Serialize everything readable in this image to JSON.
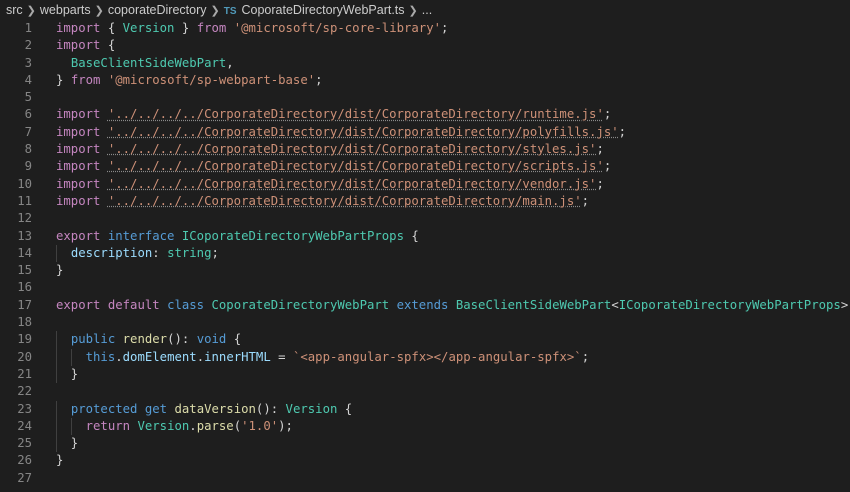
{
  "breadcrumb": {
    "items": [
      "src",
      "webparts",
      "coporateDirectory"
    ],
    "file_icon": "TS",
    "file_name": "CoporateDirectoryWebPart.ts",
    "trailing": "..."
  },
  "editor": {
    "language": "typescript",
    "theme": "dark",
    "lines": [
      {
        "num": "1",
        "tokens": [
          {
            "c": "k",
            "t": "import"
          },
          {
            "c": "p",
            "t": " { "
          },
          {
            "c": "t",
            "t": "Version"
          },
          {
            "c": "p",
            "t": " } "
          },
          {
            "c": "k",
            "t": "from"
          },
          {
            "c": "p",
            "t": " "
          },
          {
            "c": "s",
            "t": "'@microsoft/sp-core-library'"
          },
          {
            "c": "p",
            "t": ";"
          }
        ]
      },
      {
        "num": "2",
        "tokens": [
          {
            "c": "k",
            "t": "import"
          },
          {
            "c": "p",
            "t": " {"
          }
        ]
      },
      {
        "num": "3",
        "tokens": [
          {
            "c": "p",
            "t": "  "
          },
          {
            "c": "t",
            "t": "BaseClientSideWebPart"
          },
          {
            "c": "p",
            "t": ","
          }
        ]
      },
      {
        "num": "4",
        "tokens": [
          {
            "c": "p",
            "t": "} "
          },
          {
            "c": "k",
            "t": "from"
          },
          {
            "c": "p",
            "t": " "
          },
          {
            "c": "s",
            "t": "'@microsoft/sp-webpart-base'"
          },
          {
            "c": "p",
            "t": ";"
          }
        ]
      },
      {
        "num": "5",
        "tokens": []
      },
      {
        "num": "6",
        "tokens": [
          {
            "c": "k",
            "t": "import"
          },
          {
            "c": "p",
            "t": " "
          },
          {
            "c": "s sq",
            "t": "'../../../../CorporateDirectory/dist/CorporateDirectory/runtime.js'"
          },
          {
            "c": "p",
            "t": ";"
          }
        ]
      },
      {
        "num": "7",
        "tokens": [
          {
            "c": "k",
            "t": "import"
          },
          {
            "c": "p",
            "t": " "
          },
          {
            "c": "s sq",
            "t": "'../../../../CorporateDirectory/dist/CorporateDirectory/polyfills.js'"
          },
          {
            "c": "p",
            "t": ";"
          }
        ]
      },
      {
        "num": "8",
        "tokens": [
          {
            "c": "k",
            "t": "import"
          },
          {
            "c": "p",
            "t": " "
          },
          {
            "c": "s sq",
            "t": "'../../../../CorporateDirectory/dist/CorporateDirectory/styles.js'"
          },
          {
            "c": "p",
            "t": ";"
          }
        ]
      },
      {
        "num": "9",
        "tokens": [
          {
            "c": "k",
            "t": "import"
          },
          {
            "c": "p",
            "t": " "
          },
          {
            "c": "s sq",
            "t": "'../../../../CorporateDirectory/dist/CorporateDirectory/scripts.js'"
          },
          {
            "c": "p",
            "t": ";"
          }
        ]
      },
      {
        "num": "10",
        "tokens": [
          {
            "c": "k",
            "t": "import"
          },
          {
            "c": "p",
            "t": " "
          },
          {
            "c": "s sq",
            "t": "'../../../../CorporateDirectory/dist/CorporateDirectory/vendor.js'"
          },
          {
            "c": "p",
            "t": ";"
          }
        ]
      },
      {
        "num": "11",
        "tokens": [
          {
            "c": "k",
            "t": "import"
          },
          {
            "c": "p",
            "t": " "
          },
          {
            "c": "s sq",
            "t": "'../../../../CorporateDirectory/dist/CorporateDirectory/main.js'"
          },
          {
            "c": "p",
            "t": ";"
          }
        ]
      },
      {
        "num": "12",
        "tokens": []
      },
      {
        "num": "13",
        "tokens": [
          {
            "c": "k",
            "t": "export"
          },
          {
            "c": "p",
            "t": " "
          },
          {
            "c": "b",
            "t": "interface"
          },
          {
            "c": "p",
            "t": " "
          },
          {
            "c": "t",
            "t": "ICoporateDirectoryWebPartProps"
          },
          {
            "c": "p",
            "t": " {"
          }
        ]
      },
      {
        "num": "14",
        "tokens": [
          {
            "c": "p",
            "t": "  "
          },
          {
            "c": "v",
            "t": "description"
          },
          {
            "c": "p",
            "t": ": "
          },
          {
            "c": "t",
            "t": "string"
          },
          {
            "c": "p",
            "t": ";"
          }
        ]
      },
      {
        "num": "15",
        "tokens": [
          {
            "c": "p",
            "t": "}"
          }
        ]
      },
      {
        "num": "16",
        "tokens": []
      },
      {
        "num": "17",
        "tokens": [
          {
            "c": "k",
            "t": "export"
          },
          {
            "c": "p",
            "t": " "
          },
          {
            "c": "k",
            "t": "default"
          },
          {
            "c": "p",
            "t": " "
          },
          {
            "c": "b",
            "t": "class"
          },
          {
            "c": "p",
            "t": " "
          },
          {
            "c": "t",
            "t": "CoporateDirectoryWebPart"
          },
          {
            "c": "p",
            "t": " "
          },
          {
            "c": "b",
            "t": "extends"
          },
          {
            "c": "p",
            "t": " "
          },
          {
            "c": "t",
            "t": "BaseClientSideWebPart"
          },
          {
            "c": "p",
            "t": "<"
          },
          {
            "c": "t",
            "t": "ICoporateDirectoryWebPartProps"
          },
          {
            "c": "p",
            "t": "> {"
          }
        ]
      },
      {
        "num": "18",
        "tokens": []
      },
      {
        "num": "19",
        "tokens": [
          {
            "c": "p",
            "t": "  "
          },
          {
            "c": "b",
            "t": "public"
          },
          {
            "c": "p",
            "t": " "
          },
          {
            "c": "f",
            "t": "render"
          },
          {
            "c": "p",
            "t": "(): "
          },
          {
            "c": "b",
            "t": "void"
          },
          {
            "c": "p",
            "t": " {"
          }
        ]
      },
      {
        "num": "20",
        "tokens": [
          {
            "c": "p",
            "t": "    "
          },
          {
            "c": "b",
            "t": "this"
          },
          {
            "c": "p",
            "t": "."
          },
          {
            "c": "v",
            "t": "domElement"
          },
          {
            "c": "p",
            "t": "."
          },
          {
            "c": "v",
            "t": "innerHTML"
          },
          {
            "c": "p",
            "t": " = "
          },
          {
            "c": "s",
            "t": "`<app-angular-spfx></app-angular-spfx>`"
          },
          {
            "c": "p",
            "t": ";"
          }
        ]
      },
      {
        "num": "21",
        "tokens": [
          {
            "c": "p",
            "t": "  }"
          }
        ]
      },
      {
        "num": "22",
        "tokens": []
      },
      {
        "num": "23",
        "tokens": [
          {
            "c": "p",
            "t": "  "
          },
          {
            "c": "b",
            "t": "protected"
          },
          {
            "c": "p",
            "t": " "
          },
          {
            "c": "b",
            "t": "get"
          },
          {
            "c": "p",
            "t": " "
          },
          {
            "c": "f",
            "t": "dataVersion"
          },
          {
            "c": "p",
            "t": "(): "
          },
          {
            "c": "t",
            "t": "Version"
          },
          {
            "c": "p",
            "t": " {"
          }
        ]
      },
      {
        "num": "24",
        "tokens": [
          {
            "c": "p",
            "t": "    "
          },
          {
            "c": "k",
            "t": "return"
          },
          {
            "c": "p",
            "t": " "
          },
          {
            "c": "t",
            "t": "Version"
          },
          {
            "c": "p",
            "t": "."
          },
          {
            "c": "f",
            "t": "parse"
          },
          {
            "c": "p",
            "t": "("
          },
          {
            "c": "s",
            "t": "'1.0'"
          },
          {
            "c": "p",
            "t": ");"
          }
        ]
      },
      {
        "num": "25",
        "tokens": [
          {
            "c": "p",
            "t": "  }"
          }
        ]
      },
      {
        "num": "26",
        "tokens": [
          {
            "c": "p",
            "t": "}"
          }
        ]
      },
      {
        "num": "27",
        "tokens": []
      }
    ]
  }
}
